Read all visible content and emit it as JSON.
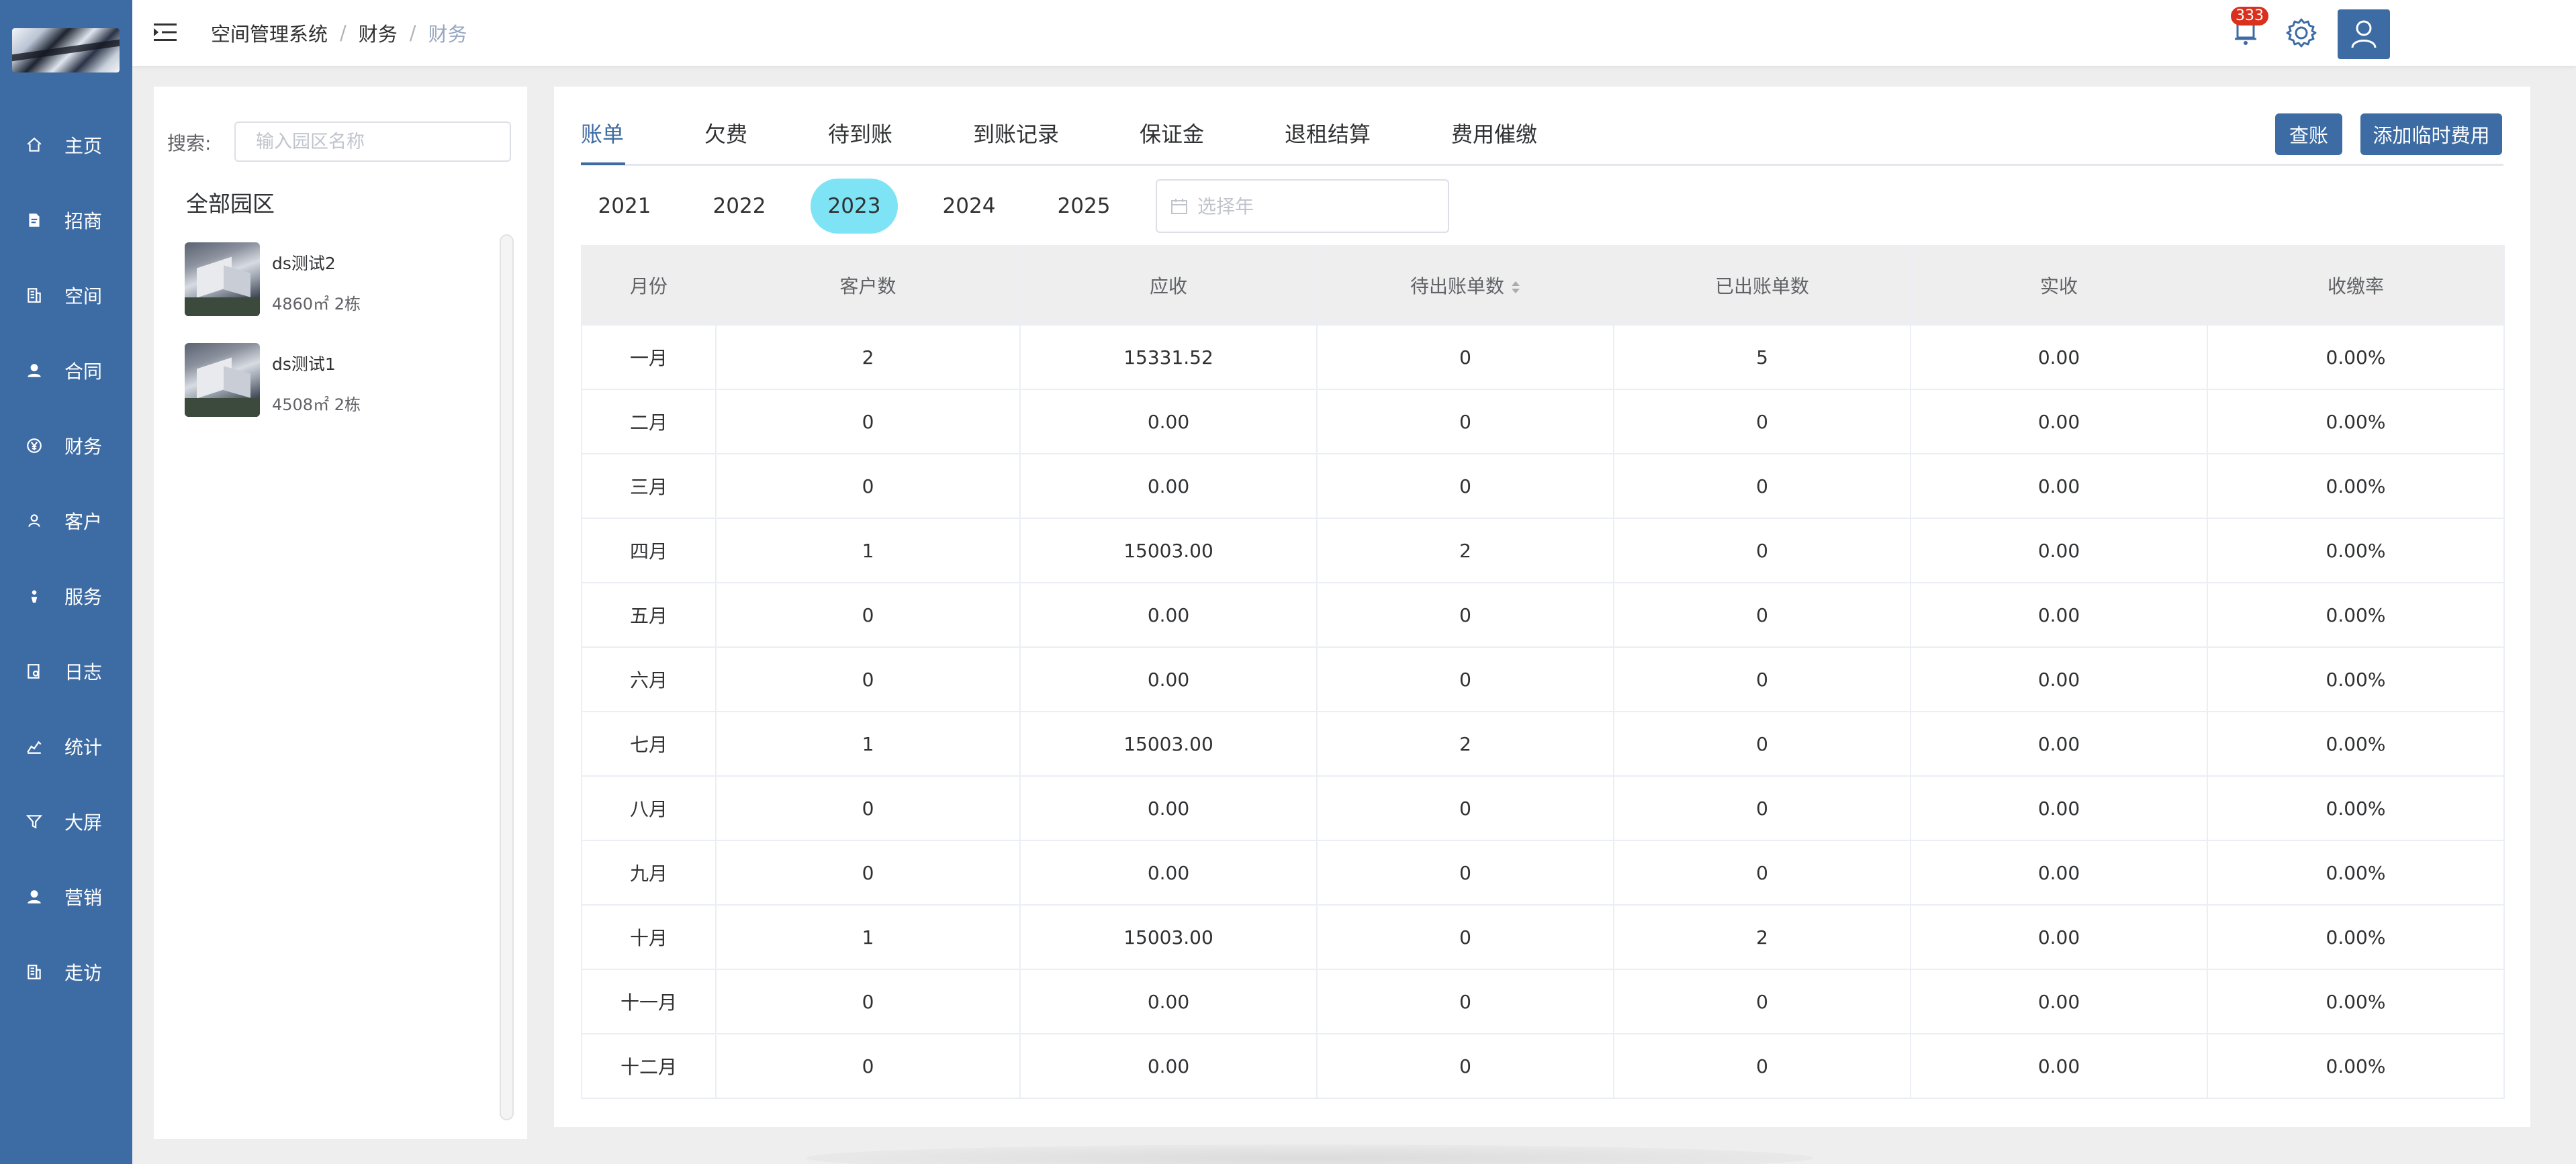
{
  "sidebar": {
    "items": [
      {
        "label": "主页",
        "icon": "home-icon"
      },
      {
        "label": "招商",
        "icon": "document-icon"
      },
      {
        "label": "空间",
        "icon": "building-icon"
      },
      {
        "label": "合同",
        "icon": "user-icon"
      },
      {
        "label": "财务",
        "icon": "yen-icon"
      },
      {
        "label": "客户",
        "icon": "person-icon"
      },
      {
        "label": "服务",
        "icon": "service-icon"
      },
      {
        "label": "日志",
        "icon": "log-icon"
      },
      {
        "label": "统计",
        "icon": "chart-icon"
      },
      {
        "label": "大屏",
        "icon": "funnel-icon"
      },
      {
        "label": "营销",
        "icon": "marketing-icon"
      },
      {
        "label": "走访",
        "icon": "visit-icon"
      }
    ]
  },
  "header": {
    "breadcrumb": [
      "空间管理系统",
      "财务",
      "财务"
    ],
    "separator": "/",
    "notification_count": "333"
  },
  "left_panel": {
    "search_label": "搜索:",
    "search_placeholder": "输入园区名称",
    "search_value": "",
    "tree_root": "全部园区",
    "parks": [
      {
        "name": "ds测试2",
        "meta": "4860㎡ 2栋"
      },
      {
        "name": "ds测试1",
        "meta": "4508㎡ 2栋"
      }
    ]
  },
  "main": {
    "tabs": [
      {
        "label": "账单",
        "active": true
      },
      {
        "label": "欠费",
        "active": false
      },
      {
        "label": "待到账",
        "active": false
      },
      {
        "label": "到账记录",
        "active": false
      },
      {
        "label": "保证金",
        "active": false
      },
      {
        "label": "退租结算",
        "active": false
      },
      {
        "label": "费用催缴",
        "active": false
      }
    ],
    "actions": {
      "check_label": "查账",
      "add_temp_fee_label": "添加临时费用"
    },
    "years": [
      "2021",
      "2022",
      "2023",
      "2024",
      "2025"
    ],
    "selected_year": "2023",
    "year_picker_placeholder": "选择年",
    "table": {
      "columns": [
        "月份",
        "客户数",
        "应收",
        "待出账单数",
        "已出账单数",
        "实收",
        "收缴率"
      ],
      "rows": [
        [
          "一月",
          "2",
          "15331.52",
          "0",
          "5",
          "0.00",
          "0.00%"
        ],
        [
          "二月",
          "0",
          "0.00",
          "0",
          "0",
          "0.00",
          "0.00%"
        ],
        [
          "三月",
          "0",
          "0.00",
          "0",
          "0",
          "0.00",
          "0.00%"
        ],
        [
          "四月",
          "1",
          "15003.00",
          "2",
          "0",
          "0.00",
          "0.00%"
        ],
        [
          "五月",
          "0",
          "0.00",
          "0",
          "0",
          "0.00",
          "0.00%"
        ],
        [
          "六月",
          "0",
          "0.00",
          "0",
          "0",
          "0.00",
          "0.00%"
        ],
        [
          "七月",
          "1",
          "15003.00",
          "2",
          "0",
          "0.00",
          "0.00%"
        ],
        [
          "八月",
          "0",
          "0.00",
          "0",
          "0",
          "0.00",
          "0.00%"
        ],
        [
          "九月",
          "0",
          "0.00",
          "0",
          "0",
          "0.00",
          "0.00%"
        ],
        [
          "十月",
          "1",
          "15003.00",
          "0",
          "2",
          "0.00",
          "0.00%"
        ],
        [
          "十一月",
          "0",
          "0.00",
          "0",
          "0",
          "0.00",
          "0.00%"
        ],
        [
          "十二月",
          "0",
          "0.00",
          "0",
          "0",
          "0.00",
          "0.00%"
        ]
      ]
    }
  },
  "colors": {
    "primary": "#3d6ba3",
    "selected_year_bg": "#7ee3f4",
    "badge": "#d9311e"
  }
}
